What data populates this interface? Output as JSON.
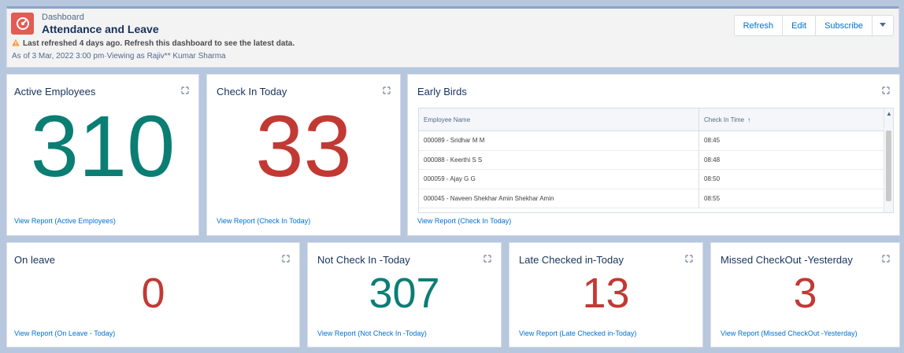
{
  "header": {
    "kicker": "Dashboard",
    "title": "Attendance and Leave",
    "warning": "Last refreshed 4 days ago. Refresh this dashboard to see the latest data.",
    "as_of": "As of 3 Mar, 2022 3:00 pm·Viewing as Rajiv** Kumar Sharma",
    "buttons": {
      "refresh": "Refresh",
      "edit": "Edit",
      "subscribe": "Subscribe"
    },
    "menu_icon": "chevron-down-icon",
    "app_icon": "dashboard-gauge-icon",
    "accent_color": "#e25c54"
  },
  "colors": {
    "teal": "#0b7e74",
    "red": "#c23934",
    "link": "#0070d2",
    "background": "#b7c7de"
  },
  "cards": {
    "active": {
      "title": "Active Employees",
      "value": "310",
      "link": "View Report (Active Employees)"
    },
    "checkin": {
      "title": "Check In Today",
      "value": "33",
      "link": "View Report (Check In Today)"
    },
    "early": {
      "title": "Early Birds",
      "link": "View Report (Check In Today)",
      "table": {
        "headers": [
          "Employee Name",
          "Check In Time"
        ],
        "rows": [
          [
            "000089 - Sridhar M M",
            "08:45"
          ],
          [
            "000088 - Keerthi S S",
            "08:48"
          ],
          [
            "000059 - Ajay G G",
            "08:50"
          ],
          [
            "000045 - Naveen Shekhar Amin Shekhar Amin",
            "08:55"
          ]
        ]
      }
    },
    "onleave": {
      "title": "On leave",
      "value": "0",
      "link": "View Report (On Leave - Today)"
    },
    "notcheckin": {
      "title": "Not Check In -Today",
      "value": "307",
      "link": "View Report (Not Check In -Today)"
    },
    "late": {
      "title": "Late Checked in-Today",
      "value": "13",
      "link": "View Report (Late Checked in-Today)"
    },
    "missed": {
      "title": "Missed CheckOut -Yesterday",
      "value": "3",
      "link": "View Report (Missed CheckOut -Yesterday)"
    }
  }
}
